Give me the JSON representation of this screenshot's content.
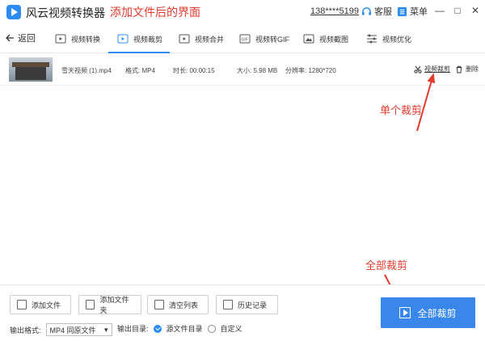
{
  "app": {
    "title": "风云视频转换器",
    "annotation": "添加文件后的界面"
  },
  "header": {
    "user": "138****5199",
    "service_label": "客服",
    "menu_label": "菜单",
    "minimize": "—",
    "maximize": "□",
    "close": "✕"
  },
  "nav": {
    "back_label": "返回",
    "tabs": [
      {
        "label": "视频转换",
        "icon": "video-convert-icon"
      },
      {
        "label": "视频裁剪",
        "icon": "video-cut-icon",
        "active": true
      },
      {
        "label": "视频合并",
        "icon": "video-merge-icon"
      },
      {
        "label": "视频转GIF",
        "icon": "gif-icon"
      },
      {
        "label": "视频截图",
        "icon": "screenshot-icon"
      },
      {
        "label": "视频优化",
        "icon": "optimize-icon"
      }
    ]
  },
  "file": {
    "name": "雪天视频 (1).mp4",
    "format": "格式: MP4",
    "duration": "时长: 00:00:15",
    "size": "大小: 5.98 MB",
    "resolution": "分辨率: 1280*720",
    "cut_label": "视频裁剪",
    "delete_label": "删除"
  },
  "annotations": {
    "single": "单个裁剪",
    "all": "全部裁剪"
  },
  "bottom": {
    "add_file": "添加文件",
    "add_folder": "添加文件夹",
    "clear_list": "清空列表",
    "history": "历史记录",
    "output_format_label": "输出格式:",
    "output_format_value": "MP4 同原文件",
    "output_dir_label": "输出目录:",
    "dir_option_source": "源文件目录",
    "dir_option_custom": "自定义",
    "cut_all_label": "全部裁剪"
  },
  "colors": {
    "accent": "#3a87ec",
    "annotation": "#e23b2e"
  }
}
